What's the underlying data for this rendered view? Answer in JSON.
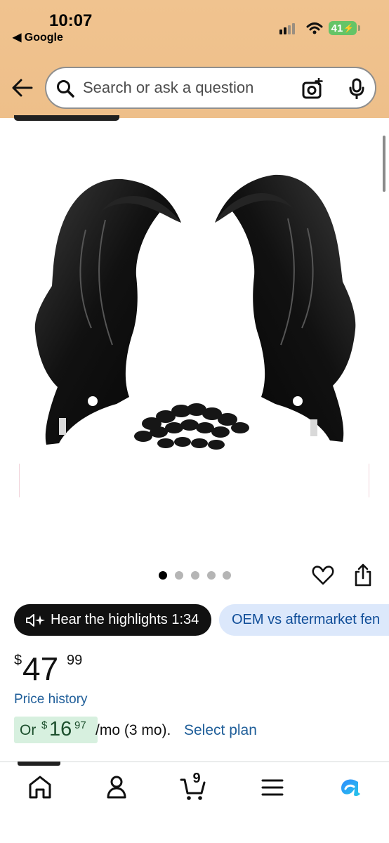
{
  "status_bar": {
    "time": "10:07",
    "back_app": "◀ Google",
    "battery": "41"
  },
  "search": {
    "placeholder": "Search or ask a question"
  },
  "gallery": {
    "image_alt": "Pair of front fender liners with plastic clips",
    "dot_count": 5,
    "active_dot": 1
  },
  "highlights": {
    "button_label": "Hear the highlights 1:34",
    "chip_label": "OEM vs aftermarket fen"
  },
  "price": {
    "symbol": "$",
    "whole": "47",
    "fraction": "99"
  },
  "price_history": "Price history",
  "installment": {
    "prefix": "Or",
    "symbol": "$",
    "whole": "16",
    "fraction": "97",
    "term": "/mo (3 mo).",
    "link": "Select plan"
  },
  "bottom_nav": {
    "cart_count": "9",
    "items": [
      "home",
      "account",
      "cart",
      "menu",
      "rufus"
    ]
  },
  "colors": {
    "header": "#eebf8a",
    "link": "#1f5e99",
    "installment_bg": "#d7f0df",
    "chip_bg": "#dce8fb"
  }
}
